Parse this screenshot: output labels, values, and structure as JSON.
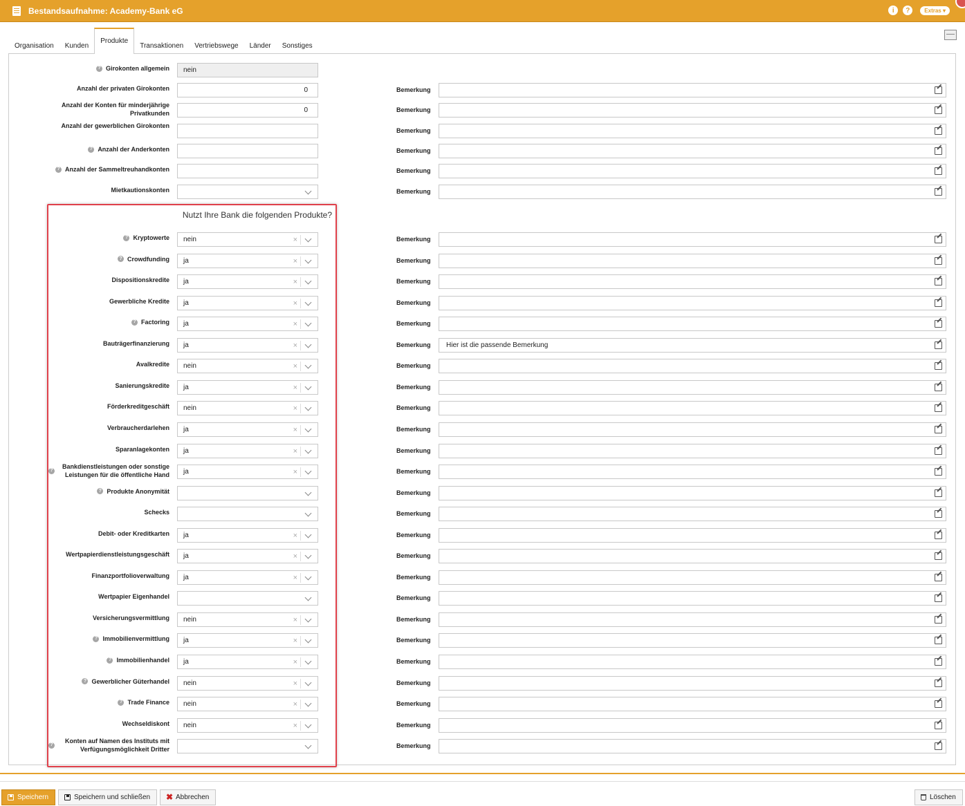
{
  "window": {
    "title": "Bestandsaufnahme: Academy-Bank eG",
    "info_icon": "i",
    "help_icon": "?",
    "extras_label": "Extras"
  },
  "tabs": [
    "Organisation",
    "Kunden",
    "Produkte",
    "Transaktionen",
    "Vertriebswege",
    "Länder",
    "Sonstiges"
  ],
  "active_tab": "Produkte",
  "remark_label": "Bemerkung",
  "top_fields": [
    {
      "label": "Girokonten allgemein",
      "help": true,
      "kind": "readonly",
      "value": "nein",
      "remark": null
    },
    {
      "label": "Anzahl der privaten Girokonten",
      "help": false,
      "kind": "number",
      "value": "0",
      "remark": ""
    },
    {
      "label": "Anzahl der Konten für minderjährige Privatkunden",
      "help": false,
      "kind": "number",
      "value": "0",
      "remark": ""
    },
    {
      "label": "Anzahl der gewerblichen Girokonten",
      "help": false,
      "kind": "number",
      "value": "",
      "remark": ""
    },
    {
      "label": "Anzahl der Anderkonten",
      "help": true,
      "kind": "number",
      "value": "",
      "remark": ""
    },
    {
      "label": "Anzahl der Sammeltreuhandkonten",
      "help": true,
      "kind": "number",
      "value": "",
      "remark": ""
    },
    {
      "label": "Mietkautionskonten",
      "help": false,
      "kind": "select",
      "value": "",
      "remark": ""
    }
  ],
  "section_title": "Nutzt Ihre Bank die folgenden Produkte?",
  "products": [
    {
      "label": "Kryptowerte",
      "help": true,
      "value": "nein",
      "remark": ""
    },
    {
      "label": "Crowdfunding",
      "help": true,
      "value": "ja",
      "remark": ""
    },
    {
      "label": "Dispositionskredite",
      "help": false,
      "value": "ja",
      "remark": ""
    },
    {
      "label": "Gewerbliche Kredite",
      "help": false,
      "value": "ja",
      "remark": ""
    },
    {
      "label": "Factoring",
      "help": true,
      "value": "ja",
      "remark": ""
    },
    {
      "label": "Bauträgerfinanzierung",
      "help": false,
      "value": "ja",
      "remark": "Hier ist die passende Bemerkung"
    },
    {
      "label": "Avalkredite",
      "help": false,
      "value": "nein",
      "remark": ""
    },
    {
      "label": "Sanierungskredite",
      "help": false,
      "value": "ja",
      "remark": ""
    },
    {
      "label": "Förderkreditgeschäft",
      "help": false,
      "value": "nein",
      "remark": ""
    },
    {
      "label": "Verbraucherdarlehen",
      "help": false,
      "value": "ja",
      "remark": ""
    },
    {
      "label": "Sparanlagekonten",
      "help": false,
      "value": "ja",
      "remark": ""
    },
    {
      "label": "Bankdienstleistungen oder sonstige Leistungen für die öffentliche Hand",
      "help": true,
      "value": "ja",
      "remark": ""
    },
    {
      "label": "Produkte Anonymität",
      "help": true,
      "value": "",
      "remark": ""
    },
    {
      "label": "Schecks",
      "help": false,
      "value": "",
      "remark": ""
    },
    {
      "label": "Debit- oder Kreditkarten",
      "help": false,
      "value": "ja",
      "remark": ""
    },
    {
      "label": "Wertpapierdienstleistungsgeschäft",
      "help": false,
      "value": "ja",
      "remark": ""
    },
    {
      "label": "Finanzportfolioverwaltung",
      "help": false,
      "value": "ja",
      "remark": ""
    },
    {
      "label": "Wertpapier Eigenhandel",
      "help": false,
      "value": "",
      "remark": ""
    },
    {
      "label": "Versicherungsvermittlung",
      "help": false,
      "value": "nein",
      "remark": ""
    },
    {
      "label": "Immobilienvermittlung",
      "help": true,
      "value": "ja",
      "remark": ""
    },
    {
      "label": "Immobilienhandel",
      "help": true,
      "value": "ja",
      "remark": ""
    },
    {
      "label": "Gewerblicher Güterhandel",
      "help": true,
      "value": "nein",
      "remark": ""
    },
    {
      "label": "Trade Finance",
      "help": true,
      "value": "nein",
      "remark": ""
    },
    {
      "label": "Wechseldiskont",
      "help": false,
      "value": "nein",
      "remark": ""
    },
    {
      "label": "Konten auf Namen des Instituts mit Verfügungsmöglichkeit Dritter",
      "help": true,
      "value": "",
      "remark": ""
    }
  ],
  "footer": {
    "save": "Speichern",
    "save_close": "Speichern und schließen",
    "cancel": "Abbrechen",
    "delete": "Löschen"
  }
}
